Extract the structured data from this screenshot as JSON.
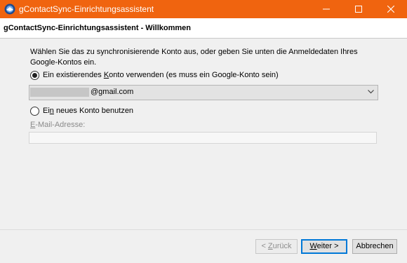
{
  "window": {
    "title": "gContactSync-Einrichtungsassistent",
    "accent_color": "#f0640f"
  },
  "header": {
    "title": "gContactSync-Einrichtungsassistent - Willkommen"
  },
  "main": {
    "intro_text": "Wählen Sie das zu synchronisierende Konto aus, oder geben Sie unten die Anmeldedaten Ihres Google-Kontos ein.",
    "option_existing": {
      "label_pre": "Ein existierendes ",
      "label_accel": "K",
      "label_post": "onto verwenden (es muss ein Google-Konto sein)",
      "checked": true
    },
    "account_select": {
      "value": "@gmail.com"
    },
    "option_new": {
      "label_pre": "Ei",
      "label_accel": "n",
      "label_post": " neues Konto benutzen",
      "checked": false
    },
    "email": {
      "label_accel": "E",
      "label_rest": "-Mail-Adresse:",
      "value": ""
    }
  },
  "buttons": {
    "back_accel": "< ",
    "back_u": "Z",
    "back_rest": "urück",
    "next_u": "W",
    "next_rest": "eiter >",
    "cancel": "Abbrechen"
  }
}
